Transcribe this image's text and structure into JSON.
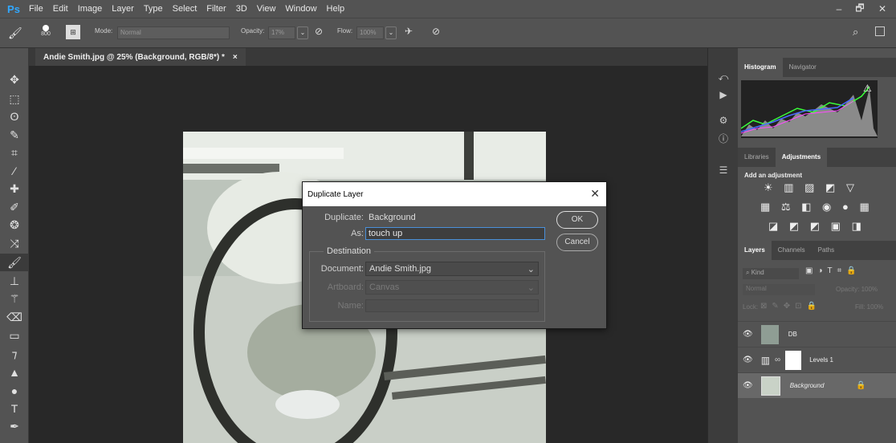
{
  "app": {
    "logo": "Ps"
  },
  "menu": [
    "File",
    "Edit",
    "Image",
    "Layer",
    "Type",
    "Select",
    "Filter",
    "3D",
    "View",
    "Window",
    "Help"
  ],
  "window_controls": {
    "minimize": "–",
    "restore": "🗗",
    "close": "✕"
  },
  "options": {
    "brush_size": "800",
    "mode_label": "Mode:",
    "mode_value": "Normal",
    "opacity_label": "Opacity:",
    "opacity_value": "17%",
    "flow_label": "Flow:",
    "flow_value": "100%"
  },
  "document": {
    "tab_title": "Andie Smith.jpg @ 25% (Background, RGB/8*) *",
    "tab_close": "×"
  },
  "dialog": {
    "title": "Duplicate Layer",
    "close": "✕",
    "duplicate_label": "Duplicate:",
    "duplicate_value": "Background",
    "as_label": "As:",
    "as_value": "touch up",
    "destination_label": "Destination",
    "document_label": "Document:",
    "document_value": "Andie Smith.jpg",
    "artboard_label": "Artboard:",
    "artboard_value": "Canvas",
    "name_label": "Name:",
    "ok": "OK",
    "cancel": "Cancel"
  },
  "panels": {
    "top_tabs": [
      "Histogram",
      "Navigator"
    ],
    "mid_tabs": [
      "Libraries",
      "Adjustments"
    ],
    "adjustments_title": "Add an adjustment",
    "layer_tabs": [
      "Layers",
      "Channels",
      "Paths"
    ],
    "kind": "Kind",
    "blend": "Normal",
    "opacity": "Opacity: 100%",
    "lock": "Lock:",
    "fill": "Fill: 100%",
    "layers": [
      {
        "name": "DB"
      },
      {
        "name": "Levels 1"
      },
      {
        "name": "Background"
      }
    ]
  }
}
